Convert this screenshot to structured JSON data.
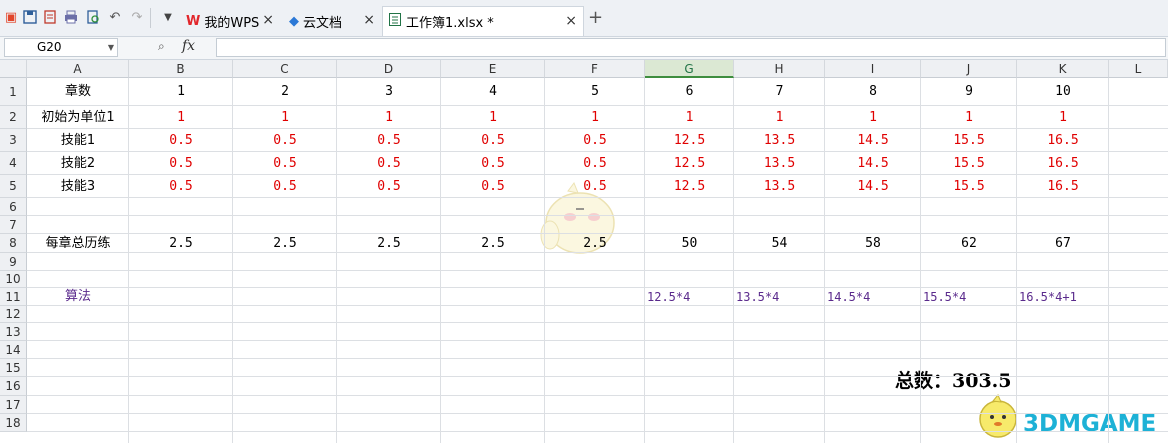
{
  "quick_access": [
    "app-logo-icon",
    "save-icon",
    "export-icon",
    "print-icon",
    "print-preview-icon",
    "undo-icon",
    "redo-icon",
    "customize-dropdown-icon"
  ],
  "tabs": [
    {
      "label": "我的WPS",
      "icon": "wps-logo-icon"
    },
    {
      "label": "云文档",
      "icon": "cloud-docs-icon"
    },
    {
      "label": "工作簿1.xlsx *",
      "icon": "spreadsheet-icon",
      "active": true
    }
  ],
  "new_tab_label": "+",
  "close_label": "×",
  "name_box": "G20",
  "fx_label": "fx",
  "columns": [
    "A",
    "B",
    "C",
    "D",
    "E",
    "F",
    "G",
    "H",
    "I",
    "J",
    "K",
    "L"
  ],
  "selected_column": "G",
  "rows": [
    "1",
    "2",
    "3",
    "4",
    "5",
    "6",
    "7",
    "8",
    "9",
    "10",
    "11",
    "12",
    "13",
    "14",
    "15",
    "16",
    "17",
    "18"
  ],
  "sheet": {
    "r1": [
      "章数",
      "1",
      "2",
      "3",
      "4",
      "5",
      "6",
      "7",
      "8",
      "9",
      "10"
    ],
    "r2": [
      "初始为单位1",
      "1",
      "1",
      "1",
      "1",
      "1",
      "1",
      "1",
      "1",
      "1",
      "1"
    ],
    "r3": [
      "技能1",
      "0.5",
      "0.5",
      "0.5",
      "0.5",
      "0.5",
      "12.5",
      "13.5",
      "14.5",
      "15.5",
      "16.5"
    ],
    "r4": [
      "技能2",
      "0.5",
      "0.5",
      "0.5",
      "0.5",
      "0.5",
      "12.5",
      "13.5",
      "14.5",
      "15.5",
      "16.5"
    ],
    "r5": [
      "技能3",
      "0.5",
      "0.5",
      "0.5",
      "0.5",
      "0.5",
      "12.5",
      "13.5",
      "14.5",
      "15.5",
      "16.5"
    ],
    "r8": [
      "每章总历练",
      "2.5",
      "2.5",
      "2.5",
      "2.5",
      "2.5",
      "50",
      "54",
      "58",
      "62",
      "67"
    ],
    "r11_label": "算法",
    "r11": [
      "12.5*4",
      "13.5*4",
      "14.5*4",
      "15.5*4",
      "16.5*4+1"
    ]
  },
  "total_text": "总数：303.5",
  "watermark": "3DMGAME",
  "colors": {
    "red": "#e00000",
    "purple": "#5a2a8c",
    "selected_header": "#dbe8d3",
    "watermark": "#1db1d6"
  }
}
